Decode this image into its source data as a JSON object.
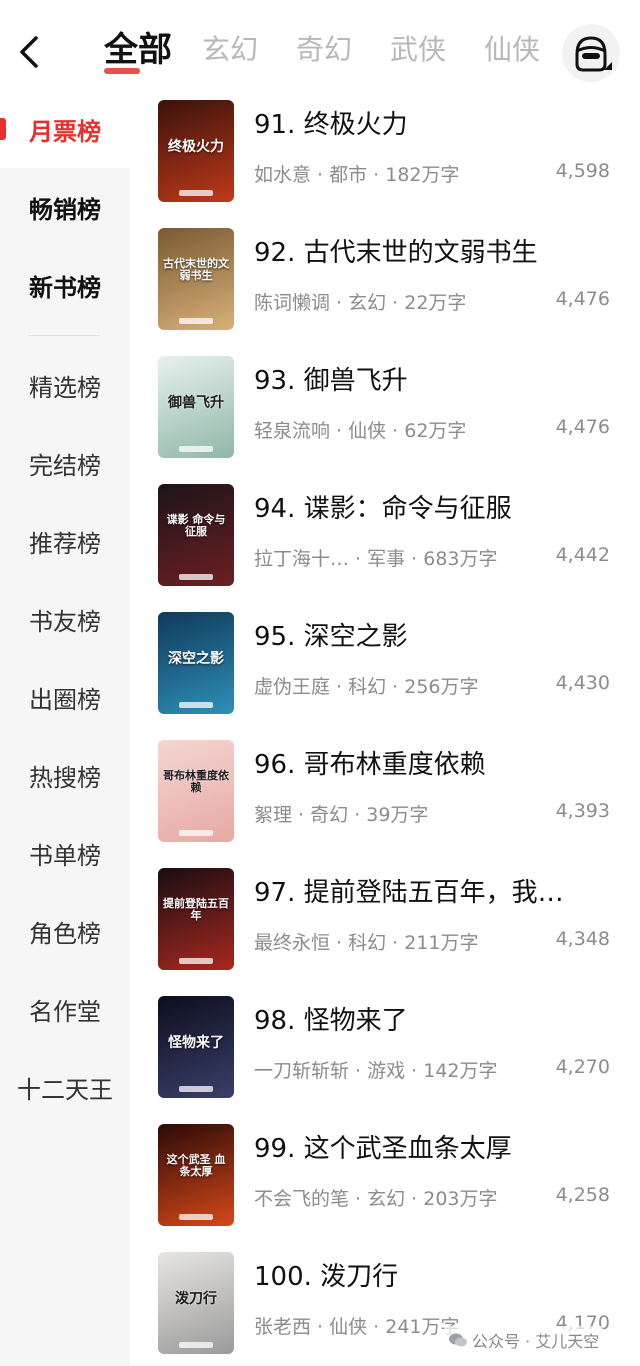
{
  "header": {
    "tabs": [
      "全部",
      "玄幻",
      "奇幻",
      "武侠",
      "仙侠"
    ],
    "active_tab": 0
  },
  "sidebar": {
    "items": [
      "月票榜",
      "畅销榜",
      "新书榜",
      "精选榜",
      "完结榜",
      "推荐榜",
      "书友榜",
      "出圈榜",
      "热搜榜",
      "书单榜",
      "角色榜",
      "名作堂",
      "十二天王"
    ],
    "active_index": 0
  },
  "books": [
    {
      "rank_title": "91. 终极火力",
      "meta": "如水意 · 都市 · 182万字",
      "count": "4,598",
      "cover_text": "终极火力",
      "cover_colors": [
        "#3a120a",
        "#c0391b"
      ]
    },
    {
      "rank_title": "92. 古代末世的文弱书生",
      "meta": "陈词懒调 · 玄幻 · 22万字",
      "count": "4,476",
      "cover_text": "古代末世的文弱书生",
      "cover_colors": [
        "#7a5a32",
        "#d8b07a"
      ]
    },
    {
      "rank_title": "93. 御兽飞升",
      "meta": "轻泉流响 · 仙侠 · 62万字",
      "count": "4,476",
      "cover_text": "御兽飞升",
      "cover_colors": [
        "#e8f1ee",
        "#8fb7a8"
      ]
    },
    {
      "rank_title": "94. 谍影：命令与征服",
      "meta": "拉丁海十…  · 军事 · 683万字",
      "count": "4,442",
      "cover_text": "谍影 命令与征服",
      "cover_colors": [
        "#1c1418",
        "#6d1f22"
      ]
    },
    {
      "rank_title": "95. 深空之影",
      "meta": "虚伪王庭 · 科幻 · 256万字",
      "count": "4,430",
      "cover_text": "深空之影",
      "cover_colors": [
        "#0f3a5a",
        "#2f8fb8"
      ]
    },
    {
      "rank_title": "96. 哥布林重度依赖",
      "meta": "絮理 · 奇幻 · 39万字",
      "count": "4,393",
      "cover_text": "哥布林重度依赖",
      "cover_colors": [
        "#f4d6d2",
        "#e7a9a3"
      ]
    },
    {
      "rank_title": "97. 提前登陆五百年，我…",
      "meta": "最终永恒 · 科幻 · 211万字",
      "count": "4,348",
      "cover_text": "提前登陆五百年",
      "cover_colors": [
        "#1a0d12",
        "#a8281e"
      ]
    },
    {
      "rank_title": "98. 怪物来了",
      "meta": "一刀斩斩斩 · 游戏 · 142万字",
      "count": "4,270",
      "cover_text": "怪物来了",
      "cover_colors": [
        "#0c0e1c",
        "#3a3f6a"
      ]
    },
    {
      "rank_title": "99. 这个武圣血条太厚",
      "meta": "不会飞的笔 · 玄幻 · 203万字",
      "count": "4,258",
      "cover_text": "这个武圣 血条太厚",
      "cover_colors": [
        "#2a0a06",
        "#d8481a"
      ]
    },
    {
      "rank_title": "100. 泼刀行",
      "meta": "张老西 · 仙侠 · 241万字",
      "count": "4,170",
      "cover_text": "泼刀行",
      "cover_colors": [
        "#e8e6e3",
        "#9a9a9a"
      ]
    }
  ],
  "watermark": {
    "text": "公众号 · 艾儿天空"
  },
  "colors": {
    "accent": "#e5322d",
    "muted": "#8c8c8c"
  }
}
